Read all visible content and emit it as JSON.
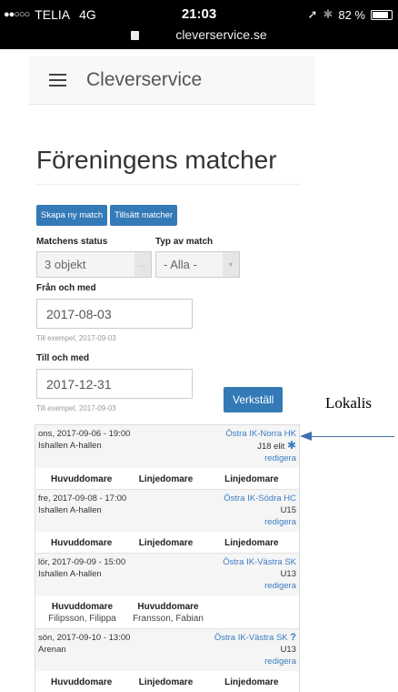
{
  "status_bar": {
    "carrier": "TELIA",
    "network": "4G",
    "time": "21:03",
    "url": "cleverservice.se",
    "battery": "82 %",
    "signal_dots": "●●○○○"
  },
  "nav": {
    "brand": "Cleverservice"
  },
  "page_title": "Föreningens matcher",
  "buttons": {
    "create": "Skapa ny match",
    "assign": "Tillsätt matcher",
    "apply": "Verkställ"
  },
  "filters": {
    "status_label": "Matchens status",
    "status_value": "3 objekt",
    "type_label": "Typ av match",
    "type_value": "- Alla -",
    "from_label": "Från och med",
    "from_value": "2017-08-03",
    "from_hint": "Till exempel, 2017-09-03",
    "to_label": "Till och med",
    "to_value": "2017-12-31",
    "to_hint": "Till exempel, 2017-09-03"
  },
  "matches": [
    {
      "datetime": "ons, 2017-09-06 - 19:00",
      "venue": "Ishallen A-hallen",
      "teams": "Östra IK-Norra HK",
      "category": "J18 elit",
      "mark": "✱",
      "edit": "redigera",
      "referees": [
        {
          "role": "Huvuddomare",
          "person": ""
        },
        {
          "role": "Linjedomare",
          "person": ""
        },
        {
          "role": "Linjedomare",
          "person": ""
        }
      ]
    },
    {
      "datetime": "fre, 2017-09-08 - 17:00",
      "venue": "Ishallen A-hallen",
      "teams": "Östra IK-Södra HC",
      "category": "U15",
      "mark": "",
      "edit": "redigera",
      "referees": [
        {
          "role": "Huvuddomare",
          "person": ""
        },
        {
          "role": "Linjedomare",
          "person": ""
        },
        {
          "role": "Linjedomare",
          "person": ""
        }
      ]
    },
    {
      "datetime": "lör, 2017-09-09 - 15:00",
      "venue": "Ishallen A-hallen",
      "teams": "Östra IK-Västra SK",
      "category": "U13",
      "mark": "",
      "edit": "redigera",
      "referees": [
        {
          "role": "Huvuddomare",
          "person": "Filipsson, Filippa"
        },
        {
          "role": "Huvuddomare",
          "person": "Fransson, Fabian"
        }
      ]
    },
    {
      "datetime": "sön, 2017-09-10 - 13:00",
      "venue": "Arenan",
      "teams": "Östra IK-Västra SK",
      "category": "U13",
      "mark": "?",
      "edit": "redigera",
      "referees": [
        {
          "role": "Huvuddomare",
          "person": ""
        },
        {
          "role": "Linjedomare",
          "person": ""
        },
        {
          "role": "Linjedomare",
          "person": ""
        }
      ]
    }
  ],
  "annotation": {
    "text": "Lokalis"
  },
  "colors": {
    "accent": "#337ab7",
    "link": "#3a7cc1",
    "arrow": "#3f6fb1"
  }
}
